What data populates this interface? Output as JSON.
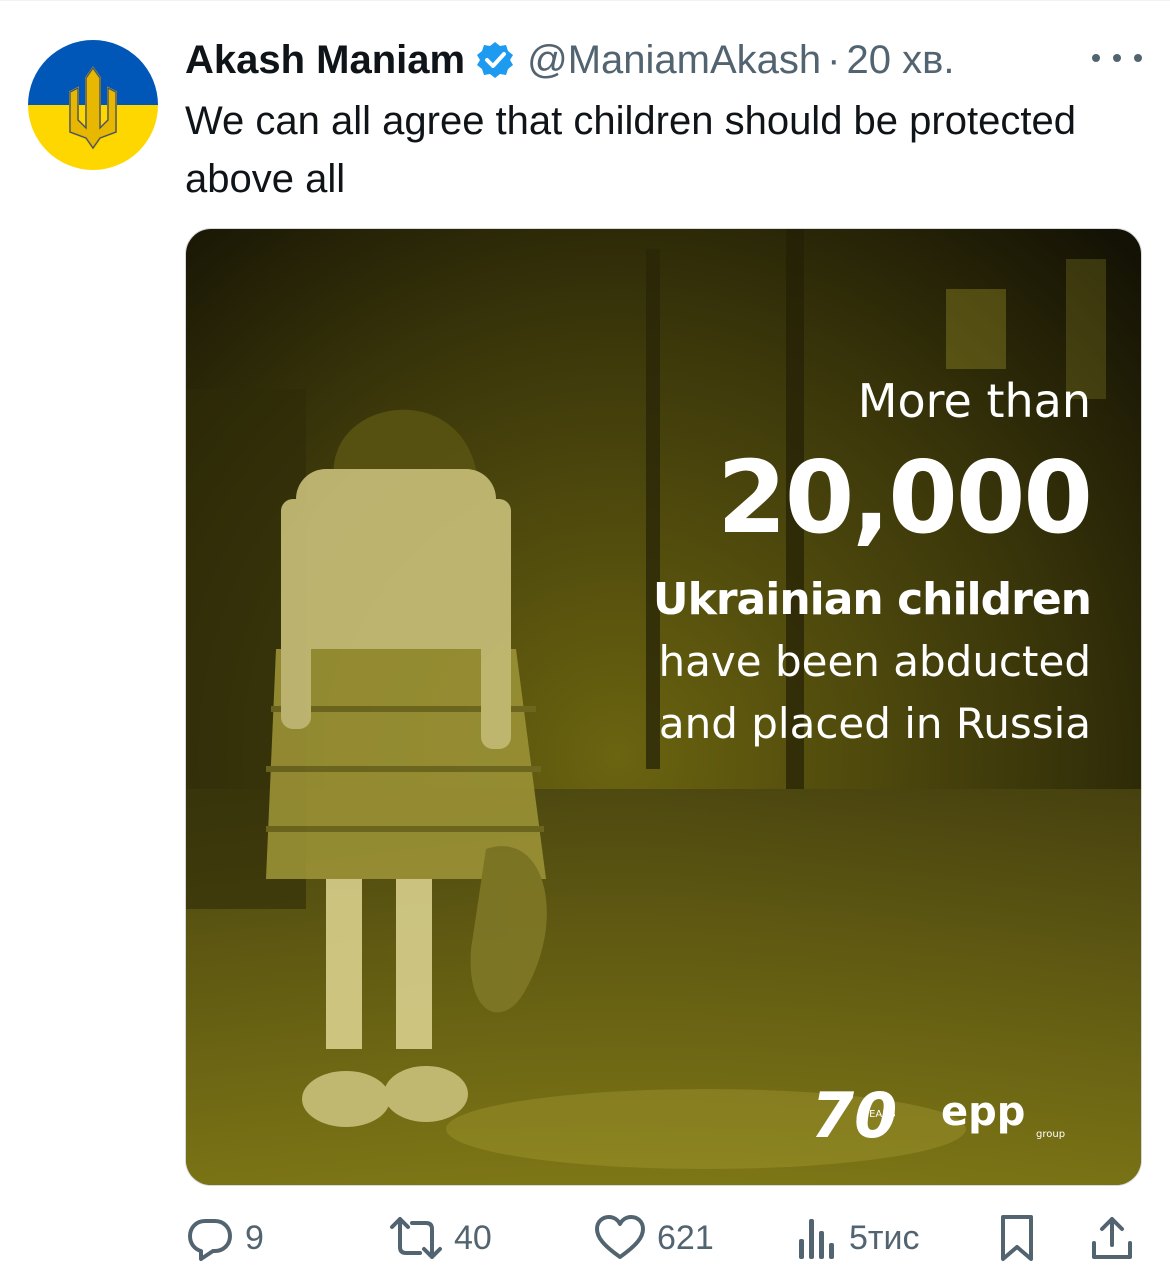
{
  "tweet": {
    "author_name": "Akash Maniam",
    "handle": "@ManiamAkash",
    "separator": "·",
    "time": "20 хв.",
    "text": "We can all agree that children should be protected above all",
    "avatar_icon": "ukraine-trident-icon",
    "verified_icon": "verified-badge-icon",
    "more_icon": "more-dots-icon"
  },
  "media": {
    "line1": "More than",
    "line2": "20,000",
    "line3": "Ukrainian children",
    "line4": "have been abducted",
    "line5": "and placed in Russia",
    "logo_years_number": "70",
    "logo_years_label": "YEARS",
    "logo_epp": "epp",
    "logo_epp_group": "group",
    "tint_color": "#8a8218"
  },
  "actions": {
    "replies": "9",
    "retweets": "40",
    "likes": "621",
    "views": "5тис",
    "reply_icon": "reply-icon",
    "retweet_icon": "retweet-icon",
    "like_icon": "heart-icon",
    "views_icon": "views-chart-icon",
    "bookmark_icon": "bookmark-icon",
    "share_icon": "share-icon"
  },
  "colors": {
    "text": "#0f1419",
    "secondary": "#536471",
    "verified": "#1d9bf0",
    "ukraine_blue": "#0057b7",
    "ukraine_yellow": "#ffd700"
  }
}
